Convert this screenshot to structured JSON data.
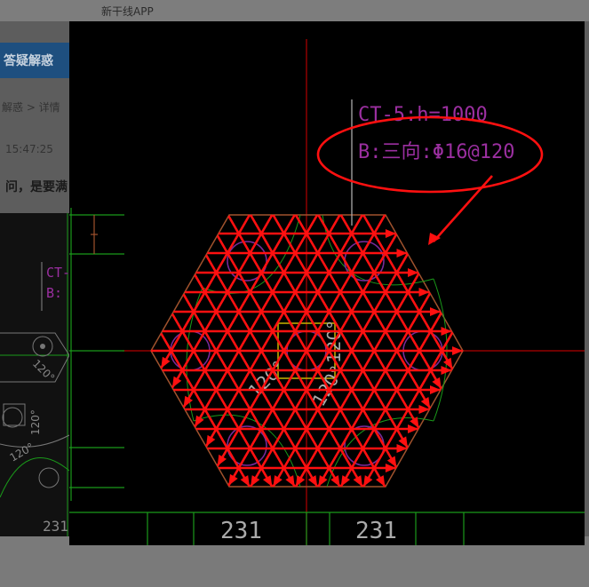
{
  "app": {
    "title": "新干线APP"
  },
  "page": {
    "header_title": "答疑解惑",
    "breadcrumb": "解惑 > 详情",
    "timestamp": "15:47:25",
    "question_snippet": "问，是要满"
  },
  "drawing": {
    "annotation_line1": "CT-5:h=1000",
    "annotation_line2": "B:三向:Φ16@120",
    "dimension_left": "231",
    "dimension_right": "231",
    "left_panel_dimension": "231",
    "left_panel_label1": "CT-",
    "left_panel_label2": "B:",
    "angle_labels": [
      "120°",
      "120°",
      "120°"
    ],
    "colors": {
      "background": "#000000",
      "rebar": "#ff1010",
      "outline": "#a0522d",
      "text_magenta": "#9b2fa0",
      "axis": "#b00000",
      "grid_green": "#1a9a1a",
      "pile_circle": "#7a2a9a"
    }
  }
}
